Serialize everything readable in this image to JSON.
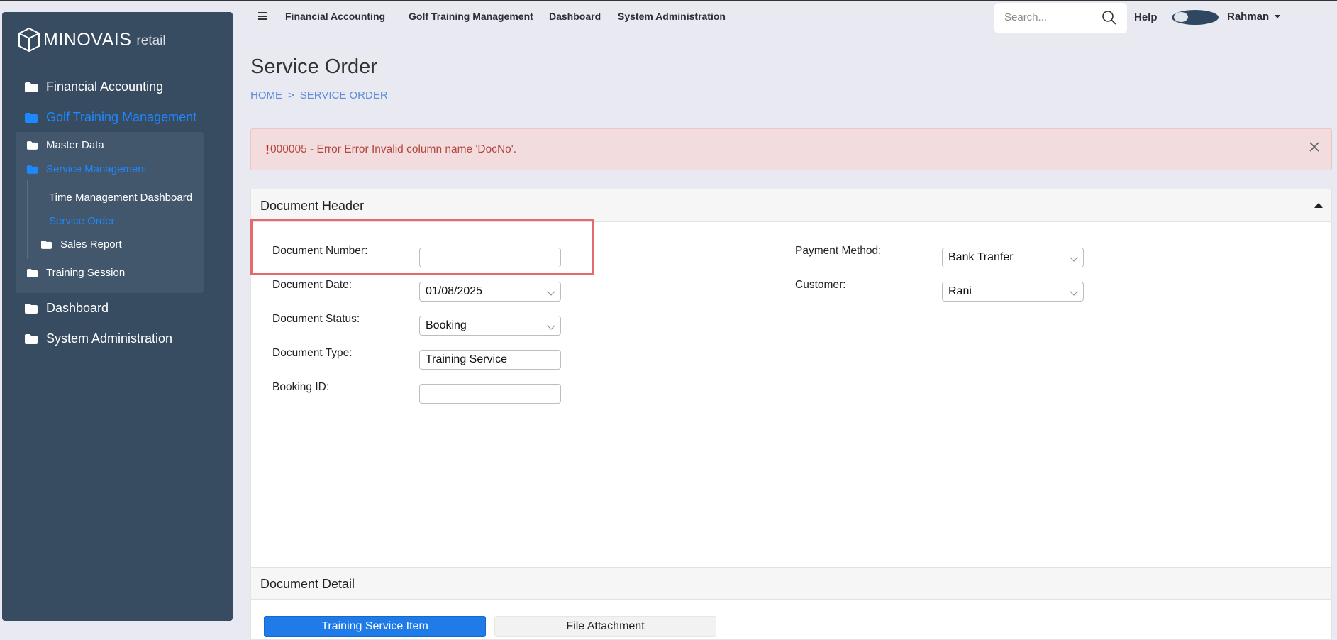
{
  "sidebar": {
    "logo": {
      "main": "MINOVAIS",
      "sub": "retail"
    },
    "items": [
      {
        "label": "Financial Accounting"
      },
      {
        "label": "Golf Training Management"
      },
      {
        "label": "Dashboard"
      },
      {
        "label": "System Administration"
      }
    ],
    "sub_items": [
      {
        "label": "Master Data"
      },
      {
        "label": "Service Management"
      },
      {
        "label": "Time Management Dashboard"
      },
      {
        "label": "Service Order"
      },
      {
        "label": "Sales Report"
      },
      {
        "label": "Training Session"
      }
    ]
  },
  "topnav": {
    "items": [
      {
        "label": "Financial Accounting"
      },
      {
        "label": "Golf Training Management"
      },
      {
        "label": "Dashboard"
      },
      {
        "label": "System Administration"
      }
    ],
    "search_placeholder": "Search...",
    "help_label": "Help",
    "user_name": "Rahman"
  },
  "page": {
    "title": "Service Order",
    "breadcrumb": {
      "home": "HOME",
      "separator": ">",
      "current": "SERVICE ORDER"
    }
  },
  "alert": {
    "icon": "!",
    "message": "000005 - Error Error Invalid column name 'DocNo'."
  },
  "document_header": {
    "title": "Document Header",
    "fields": {
      "document_number": {
        "label": "Document Number:",
        "value": ""
      },
      "document_date": {
        "label": "Document Date:",
        "value": "01/08/2025"
      },
      "document_status": {
        "label": "Document Status:",
        "value": "Booking"
      },
      "document_type": {
        "label": "Document Type:",
        "value": "Training Service"
      },
      "booking_id": {
        "label": "Booking ID:",
        "value": ""
      },
      "payment_method": {
        "label": "Payment Method:",
        "value": "Bank Tranfer"
      },
      "customer": {
        "label": "Customer:",
        "value": "Rani"
      }
    }
  },
  "document_detail": {
    "title": "Document Detail",
    "tabs": [
      {
        "label": "Training Service Item"
      },
      {
        "label": "File Attachment"
      }
    ]
  },
  "colors": {
    "sidebar_bg": "#374b61",
    "accent": "#1e88ff",
    "alert_bg": "#f2dcdd",
    "highlight": "#e36b6b"
  }
}
